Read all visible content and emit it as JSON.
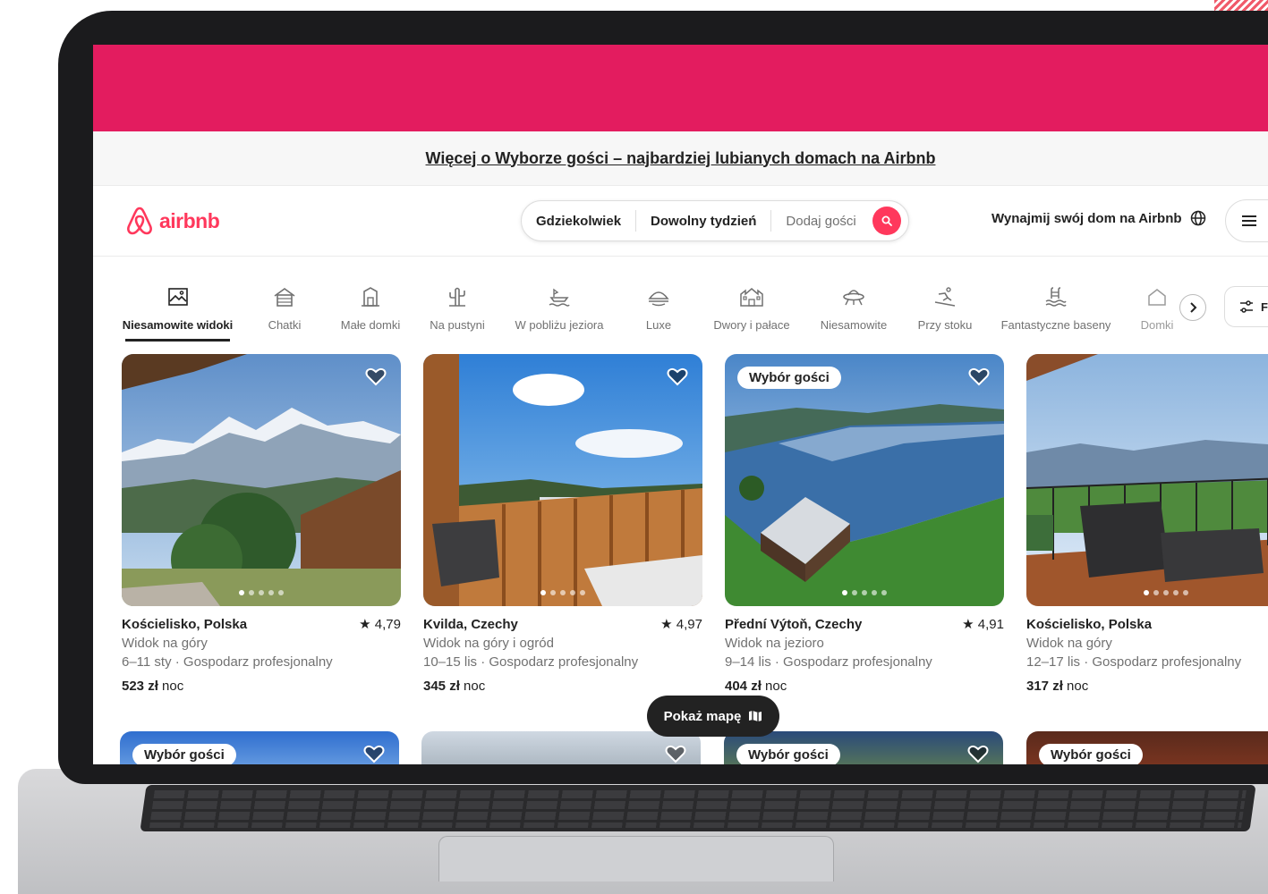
{
  "promo": {
    "text": "Więcej o Wyborze gości – najbardziej lubianych domach na Airbnb"
  },
  "header": {
    "logo_text": "airbnb",
    "search": {
      "where": "Gdziekolwiek",
      "when": "Dowolny tydzień",
      "guests": "Dodaj gości"
    },
    "host_link": "Wynajmij swój dom na Airbnb"
  },
  "categories": [
    {
      "label": "Niesamowite widoki",
      "icon": "panorama-icon",
      "active": true
    },
    {
      "label": "Chatki",
      "icon": "cabin-icon"
    },
    {
      "label": "Małe domki",
      "icon": "tiny-home-icon"
    },
    {
      "label": "Na pustyni",
      "icon": "cactus-icon"
    },
    {
      "label": "W pobliżu jeziora",
      "icon": "lake-icon"
    },
    {
      "label": "Luxe",
      "icon": "luxe-icon"
    },
    {
      "label": "Dwory i pałace",
      "icon": "mansion-icon"
    },
    {
      "label": "Niesamowite",
      "icon": "ufo-icon"
    },
    {
      "label": "Przy stoku",
      "icon": "skier-icon"
    },
    {
      "label": "Fantastyczne baseny",
      "icon": "pool-icon"
    },
    {
      "label": "Domki",
      "icon": "house-icon"
    }
  ],
  "filters_label": "Filtry",
  "listings": [
    {
      "location": "Kościelisko, Polska",
      "rating": "4,79",
      "title": "Widok na góry",
      "dates": "6–11 sty · Gospodarz profesjonalny",
      "price": "523 zł",
      "unit": "noc",
      "badge": ""
    },
    {
      "location": "Kvilda, Czechy",
      "rating": "4,97",
      "title": "Widok na góry i ogród",
      "dates": "10–15 lis · Gospodarz profesjonalny",
      "price": "345 zł",
      "unit": "noc",
      "badge": ""
    },
    {
      "location": "Přední Výtoň, Czechy",
      "rating": "4,91",
      "title": "Widok na jezioro",
      "dates": "9–14 lis · Gospodarz profesjonalny",
      "price": "404 zł",
      "unit": "noc",
      "badge": "Wybór gości"
    },
    {
      "location": "Kościelisko, Polska",
      "rating": "",
      "title": "Widok na góry",
      "dates": "12–17 lis · Gospodarz profesjonalny",
      "price": "317 zł",
      "unit": "noc",
      "badge": ""
    }
  ],
  "second_row_badges": [
    "Wybór gości",
    "",
    "Wybór gości",
    "Wybór gości"
  ],
  "map_button": "Pokaż mapę",
  "colors": {
    "brand": "#E31C5F",
    "accent": "#FF385C",
    "text": "#222222",
    "muted": "#717171"
  }
}
